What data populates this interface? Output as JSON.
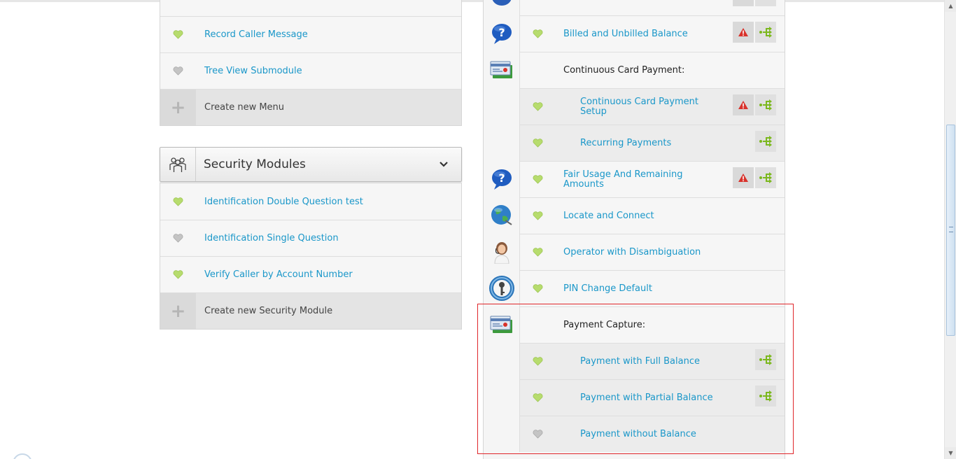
{
  "left_panel_top": {
    "items": [
      {
        "label": "Record Caller Message",
        "status": "active"
      },
      {
        "label": "Tree View Submodule",
        "status": "inactive"
      },
      {
        "label": "Create new Menu",
        "icon": "plus-icon"
      }
    ]
  },
  "security_modules": {
    "title": "Security Modules",
    "items": [
      {
        "label": "Identification Double Question test",
        "status": "active"
      },
      {
        "label": "Identification Single Question",
        "status": "inactive"
      },
      {
        "label": "Verify Caller by Account Number",
        "status": "active"
      },
      {
        "label": "Create new Security Module",
        "icon": "plus-icon"
      }
    ]
  },
  "right_list": {
    "rows": [
      {
        "label": "Billed and Unbilled Balance",
        "icon": "question-icon",
        "status": "active",
        "actions": [
          "warning",
          "tree"
        ]
      },
      {
        "label": "Continuous Card Payment:",
        "icon": "card-payment-icon",
        "group": true
      },
      {
        "label": "Continuous Card Payment Setup",
        "status": "active",
        "sub": true,
        "actions": [
          "warning",
          "tree"
        ]
      },
      {
        "label": "Recurring Payments",
        "status": "active",
        "sub": true,
        "actions": [
          "tree"
        ]
      },
      {
        "label": "Fair Usage And Remaining Amounts",
        "icon": "question-icon",
        "status": "active",
        "actions": [
          "warning",
          "tree"
        ]
      },
      {
        "label": "Locate and Connect",
        "icon": "globe-icon",
        "status": "active"
      },
      {
        "label": "Operator with Disambiguation",
        "icon": "operator-icon",
        "status": "active"
      },
      {
        "label": "PIN Change Default",
        "icon": "pin-key-icon",
        "status": "active"
      },
      {
        "label": "Payment Capture:",
        "icon": "card-payment-icon",
        "group": true
      },
      {
        "label": "Payment with Full Balance",
        "status": "active",
        "sub": true,
        "actions": [
          "tree"
        ]
      },
      {
        "label": "Payment with Partial Balance",
        "status": "active",
        "sub": true,
        "actions": [
          "tree"
        ]
      },
      {
        "label": "Payment without Balance",
        "status": "inactive",
        "sub": true
      }
    ]
  },
  "colors": {
    "link": "#1a97c9",
    "heart_active": "#b7dc6e",
    "heart_inactive": "#bdbdbd",
    "warning": "#d8322b",
    "tree": "#7cb81e",
    "highlight": "#e0262a"
  }
}
